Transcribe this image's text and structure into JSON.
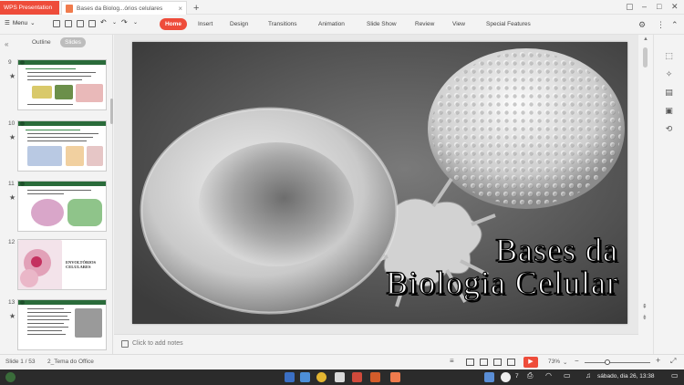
{
  "titlebar": {
    "app_tab_label": "WPS Presentation",
    "doc_tab_label": "Bases da Biolog...órios celulares",
    "doc_tab_close": "×",
    "new_tab": "+"
  },
  "menu": {
    "menu_label": "Menu",
    "ribbon_tabs": [
      "Home",
      "Insert",
      "Design",
      "Transitions",
      "Animation",
      "Slide Show",
      "Review",
      "View",
      "Special Features"
    ]
  },
  "left_panel": {
    "tab_outline": "Outline",
    "tab_slides": "Slides",
    "thumbnails": [
      {
        "number": "9",
        "star": "★"
      },
      {
        "number": "10",
        "star": "★"
      },
      {
        "number": "11",
        "star": "★"
      },
      {
        "number": "12",
        "star": "",
        "text": "ENVOLTÓRIOS CELULARES"
      },
      {
        "number": "13",
        "star": "★"
      }
    ]
  },
  "slide": {
    "title_line1": "Bases da",
    "title_line2": "Biologia Celular"
  },
  "notes": {
    "placeholder": "Click to add notes"
  },
  "statusbar": {
    "slide_counter": "Slide 1 / 53",
    "theme": "2_Tema do Office",
    "zoom": "73%",
    "zoom_minus": "−",
    "zoom_plus": "+"
  },
  "taskbar": {
    "notification_count": "7",
    "datetime": "sábado, dia 26, 13:38"
  },
  "colors": {
    "accent": "#ee4c3a",
    "thumb_header_green": "#2a6b3a"
  }
}
